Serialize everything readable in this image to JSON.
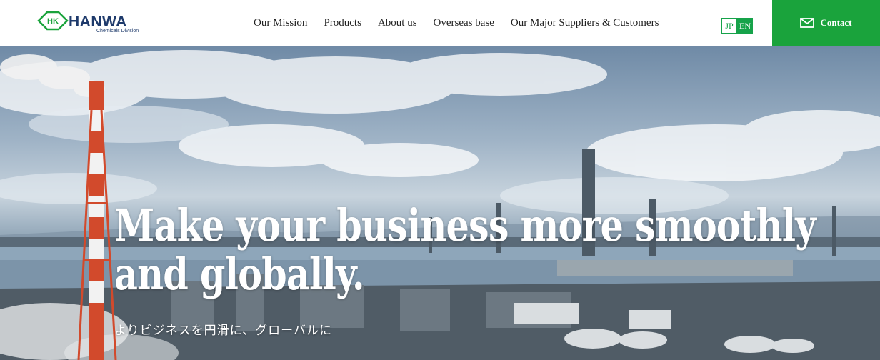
{
  "header": {
    "logo_text": "HANWA",
    "logo_subtitle": "Chemicals Division",
    "logo_badge": "HK"
  },
  "nav": {
    "items": [
      {
        "label": "Our Mission"
      },
      {
        "label": "Products"
      },
      {
        "label": "About us"
      },
      {
        "label": "Overseas base"
      },
      {
        "label": "Our Major Suppliers & Customers"
      }
    ]
  },
  "language": {
    "options": [
      "JP",
      "EN"
    ],
    "selected": "EN"
  },
  "contact": {
    "label": "Contact",
    "icon": "mail-icon"
  },
  "hero": {
    "headline_line1": "Make your business more smoothly",
    "headline_line2": "and globally.",
    "subline": "よりビジネスを円滑に、グローバルに"
  },
  "colors": {
    "brand_green": "#1aa33c",
    "logo_navy": "#1e3a6b"
  }
}
